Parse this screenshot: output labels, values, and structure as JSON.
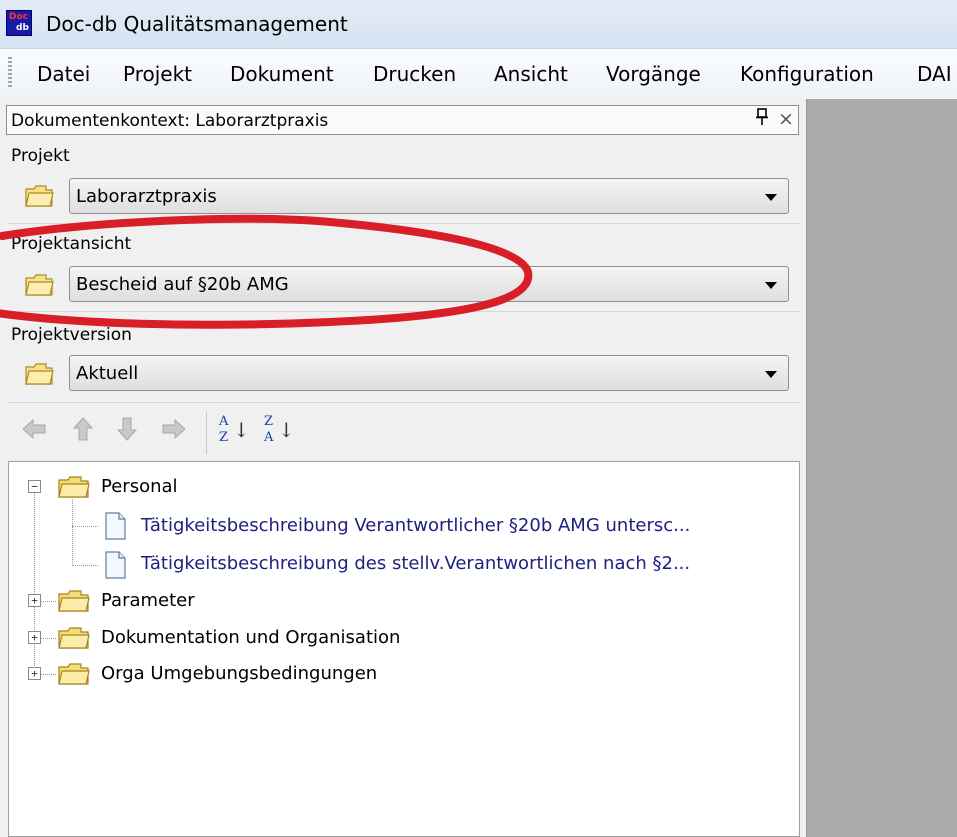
{
  "window": {
    "app_logo": {
      "line1": "Doc",
      "line2": "db"
    },
    "title": "Doc-db Qualitätsmanagement"
  },
  "menubar": {
    "items": [
      {
        "label": "Datei"
      },
      {
        "label": "Projekt"
      },
      {
        "label": "Dokument"
      },
      {
        "label": "Drucken"
      },
      {
        "label": "Ansicht"
      },
      {
        "label": "Vorgänge"
      },
      {
        "label": "Konfiguration"
      },
      {
        "label": "DAI"
      }
    ]
  },
  "panel": {
    "title": "Dokumentenkontext: Laborarztpraxis",
    "pin_glyph": "ᵽ",
    "close_glyph": "×",
    "project": {
      "label": "Projekt",
      "value": "Laborarztpraxis"
    },
    "view": {
      "label": "Projektansicht",
      "value": "Bescheid auf §20b AMG"
    },
    "version": {
      "label": "Projektversion",
      "value": "Aktuell"
    },
    "toolbar": {
      "icons": [
        "arrow-left-icon",
        "arrow-up-icon",
        "arrow-down-icon",
        "arrow-right-icon",
        "sort-az-icon",
        "sort-za-icon"
      ],
      "sort_az": {
        "top": "A",
        "bottom": "Z"
      },
      "sort_za": {
        "top": "Z",
        "bottom": "A"
      }
    }
  },
  "tree": {
    "nodes": [
      {
        "label": "Personal",
        "expanded": true,
        "expander": "−",
        "children": [
          {
            "label": "Tätigkeitsbeschreibung Verantwortlicher §20b AMG untersc..."
          },
          {
            "label": "Tätigkeitsbeschreibung des stellv.Verantwortlichen nach §2..."
          }
        ]
      },
      {
        "label": "Parameter",
        "expanded": false,
        "expander": "+"
      },
      {
        "label": "Dokumentation und Organisation",
        "expanded": false,
        "expander": "+"
      },
      {
        "label": "Orga Umgebungsbedingungen",
        "expanded": false,
        "expander": "+"
      }
    ]
  },
  "colors": {
    "annotation": "#d81e26",
    "doc_link": "#1f2080",
    "right_area": "#ababab"
  }
}
